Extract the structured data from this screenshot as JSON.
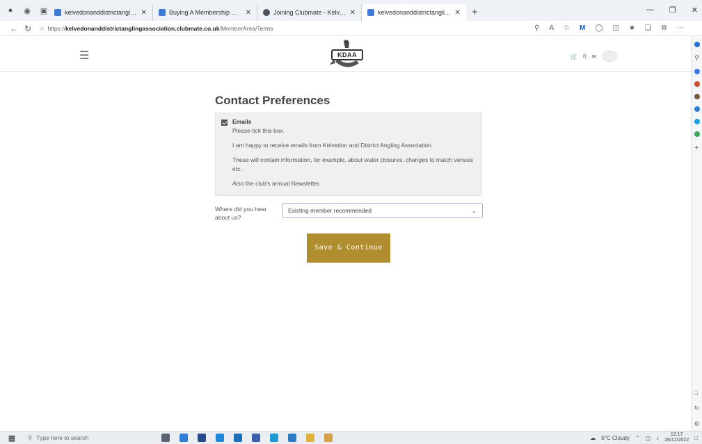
{
  "browser": {
    "tabs": [
      {
        "title": "kelvedonanddistrictanglingassoc",
        "active": false
      },
      {
        "title": "Buying A Membership Guide | Cl",
        "active": false
      },
      {
        "title": "Joining Clubmate - Kelvedon Dis",
        "active": false
      },
      {
        "title": "kelvedonanddistrictanglingassoc",
        "active": true
      }
    ],
    "url_prefix": "https://",
    "url_host": "kelvedonanddistrictanglingassociation.clubmate.co.uk",
    "url_path": "/MemberArea/Terms"
  },
  "header": {
    "logo_text": "KDAA",
    "basket_count": "0"
  },
  "main": {
    "title": "Contact Preferences",
    "preference": {
      "label": "Emails",
      "instruction": "Please tick this box.",
      "line1": "I am happy to receive emails from Kelvedon and District Angling Association.",
      "line2": "These will contain information, for example, about  water closures, changes to match venues etc.",
      "line3": "Also the club's annual Newsletter.",
      "checked": true
    },
    "hear_label": "Where did you hear about us?",
    "hear_value": "Existing member recommended",
    "save_label": "Save & Continue"
  },
  "taskbar": {
    "search_placeholder": "Type here to search",
    "weather": "5°C  Cloudy",
    "time": "12:17",
    "date": "26/12/2022"
  },
  "colors": {
    "accent_button": "#b08d2e",
    "select_border": "#b9a9d6",
    "pref_box_bg": "#f0f0f3"
  }
}
